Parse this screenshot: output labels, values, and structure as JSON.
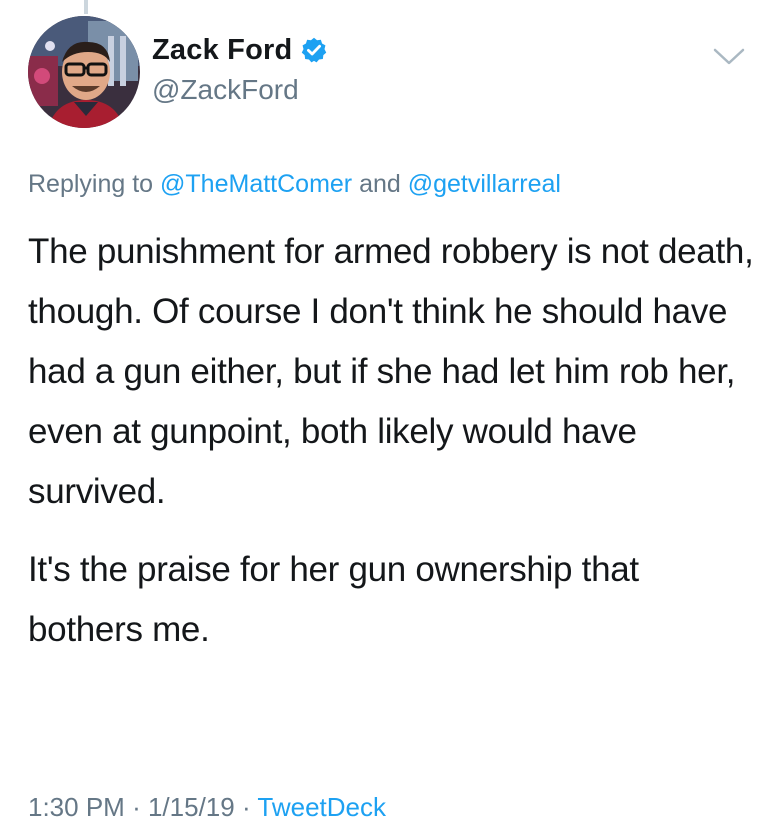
{
  "tweet": {
    "author": {
      "display_name": "Zack Ford",
      "handle": "@ZackFord",
      "verified": true,
      "avatar_icon": "profile-photo"
    },
    "reply_to": {
      "prefix": "Replying to",
      "mention_1": "@TheMattComer",
      "conjunction": "and",
      "mention_2": "@getvillarreal"
    },
    "paragraphs": [
      "The punishment for armed robbery is not death, though. Of course I don't think he should have had a gun either, but if she had let him rob her, even at gunpoint, both likely would have survived.",
      "It's the praise for her gun ownership that bothers me."
    ],
    "time": "1:30 PM",
    "separator": "·",
    "date": "1/15/19",
    "source": "TweetDeck"
  },
  "colors": {
    "text": "#14171a",
    "secondary": "#657786",
    "link": "#1da1f2",
    "verified_badge": "#1da1f2"
  },
  "icons": {
    "verified": "verified-badge-icon",
    "menu": "chevron-down-icon"
  }
}
